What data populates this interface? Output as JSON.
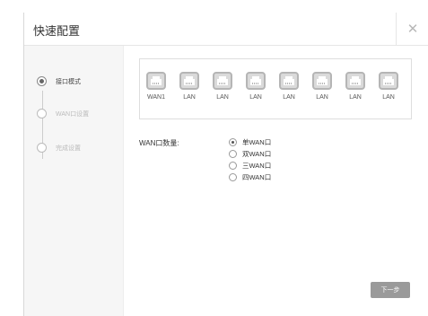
{
  "dialog": {
    "title": "快速配置",
    "close_glyph": "✕"
  },
  "steps": [
    {
      "label": "接口模式",
      "active": true
    },
    {
      "label": "WAN口设置",
      "active": false
    },
    {
      "label": "完成设置",
      "active": false
    }
  ],
  "ports": [
    "WAN1",
    "LAN",
    "LAN",
    "LAN",
    "LAN",
    "LAN",
    "LAN",
    "LAN"
  ],
  "wan_count": {
    "label": "WAN口数量:",
    "options": [
      "单WAN口",
      "双WAN口",
      "三WAN口",
      "四WAN口"
    ],
    "selected": 0
  },
  "next_button": "下一步",
  "colors": {
    "port_gray": "#dadada",
    "button_gray": "#9a9a9a"
  },
  "icons": {
    "port": "ethernet-port-icon",
    "close": "close-icon"
  }
}
